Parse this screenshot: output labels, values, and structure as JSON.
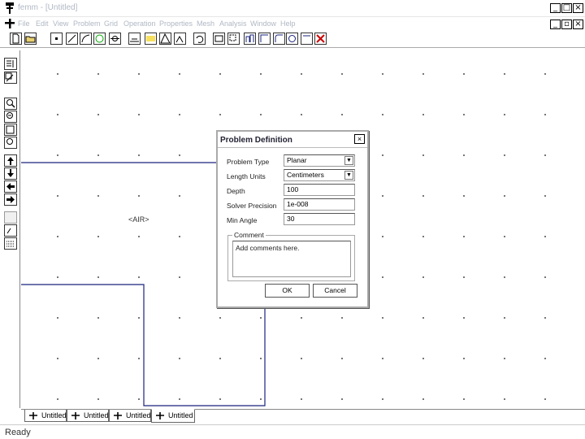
{
  "window": {
    "title": "femm - [Untitled]",
    "minimize": "_",
    "maximize": "□",
    "close": "×",
    "doc_minimize": "_",
    "doc_restore": "▫",
    "doc_close": "×"
  },
  "menu": {
    "items": [
      "File",
      "Edit",
      "View",
      "Problem",
      "Grid",
      "Operation",
      "Properties",
      "Mesh",
      "Analysis",
      "Window",
      "Help"
    ]
  },
  "canvas": {
    "region_label": "<AIR>"
  },
  "tabs": [
    {
      "label": "Untitled",
      "active": false
    },
    {
      "label": "Untitled",
      "active": false
    },
    {
      "label": "Untitled",
      "active": false
    },
    {
      "label": "Untitled",
      "active": true
    }
  ],
  "status": {
    "text": "Ready"
  },
  "dialog": {
    "title": "Problem Definition",
    "close": "×",
    "fields": {
      "problem_type_label": "Problem Type",
      "problem_type_value": "Planar",
      "length_units_label": "Length Units",
      "length_units_value": "Centimeters",
      "depth_label": "Depth",
      "depth_value": "100",
      "solver_precision_label": "Solver Precision",
      "solver_precision_value": "1e-008",
      "min_angle_label": "Min Angle",
      "min_angle_value": "30"
    },
    "comment_group_label": "Comment",
    "comment_value": "Add comments here.",
    "ok_label": "OK",
    "cancel_label": "Cancel"
  },
  "icons": {
    "app": "femm-app-icon",
    "selection_mode": "select-mode-icon"
  },
  "colors": {
    "geometry_line": "#1a237e",
    "canvas_grid_dot": "#555555",
    "disabled_text": "#b0b8c4"
  }
}
